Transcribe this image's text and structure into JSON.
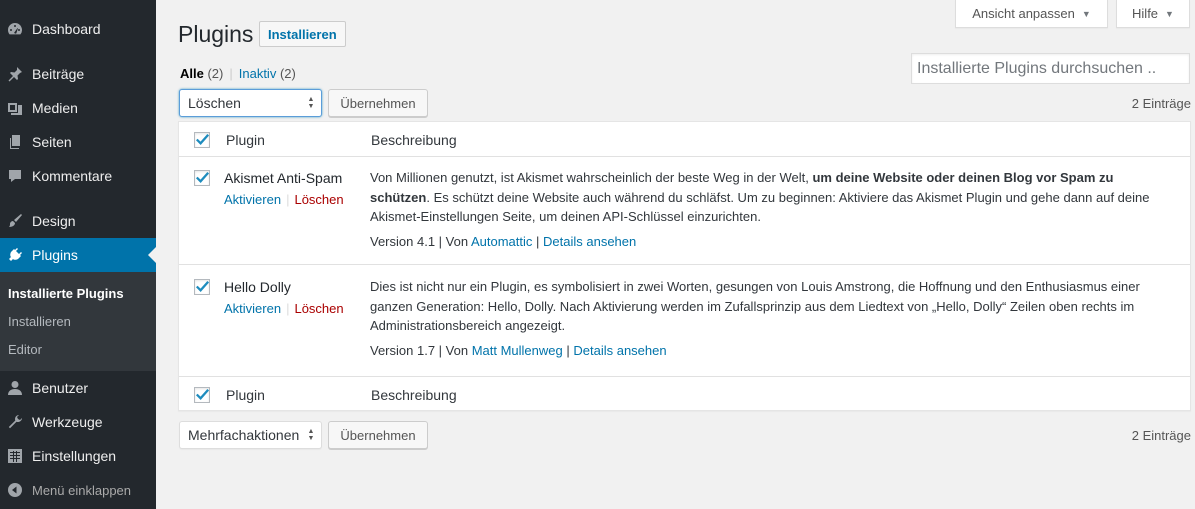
{
  "sidebar": {
    "items": [
      {
        "label": "Dashboard",
        "icon": "dashboard-icon"
      },
      {
        "label": "Beiträge",
        "icon": "pin-icon"
      },
      {
        "label": "Medien",
        "icon": "media-icon"
      },
      {
        "label": "Seiten",
        "icon": "pages-icon"
      },
      {
        "label": "Kommentare",
        "icon": "comment-icon"
      },
      {
        "label": "Design",
        "icon": "paintbrush-icon"
      },
      {
        "label": "Plugins",
        "icon": "plugin-icon"
      },
      {
        "label": "Benutzer",
        "icon": "user-icon"
      },
      {
        "label": "Werkzeuge",
        "icon": "wrench-icon"
      },
      {
        "label": "Einstellungen",
        "icon": "settings-icon"
      }
    ],
    "submenu": [
      "Installierte Plugins",
      "Installieren",
      "Editor"
    ],
    "collapse_label": "Menü einklappen"
  },
  "screen_meta": {
    "screen_options": "Ansicht anpassen",
    "help": "Hilfe"
  },
  "header": {
    "title": "Plugins",
    "add_new": "Installieren"
  },
  "filters": {
    "all_label": "Alle",
    "all_count": "(2)",
    "separator": "|",
    "inactive_label": "Inaktiv",
    "inactive_count": "(2)"
  },
  "search": {
    "placeholder": "Installierte Plugins durchsuchen .."
  },
  "bulk_top": {
    "selected": "Löschen",
    "apply": "Übernehmen",
    "count": "2 Einträge"
  },
  "bulk_bottom": {
    "selected": "Mehrfachaktionen",
    "apply": "Übernehmen",
    "count": "2 Einträge"
  },
  "table": {
    "columns": {
      "plugin": "Plugin",
      "description": "Beschreibung"
    },
    "rows": [
      {
        "name": "Akismet Anti-Spam",
        "activate": "Aktivieren",
        "delete": "Löschen",
        "desc_1": "Von Millionen genutzt, ist Akismet wahrscheinlich der beste Weg in der Welt, ",
        "desc_bold": "um deine Website oder deinen Blog vor Spam zu schützen",
        "desc_2": ". Es schützt deine Website auch während du schläfst. Um zu beginnen: Aktiviere das Akismet Plugin und gehe dann auf deine Akismet-Einstellungen Seite, um deinen API-Schlüssel einzurichten.",
        "version": "Version 4.1",
        "by": "Von",
        "author": "Automattic",
        "details": "Details ansehen"
      },
      {
        "name": "Hello Dolly",
        "activate": "Aktivieren",
        "delete": "Löschen",
        "desc": "Dies ist nicht nur ein Plugin, es symbolisiert in zwei Worten, gesungen von Louis Amstrong, die Hoffnung und den Enthusiasmus einer ganzen Generation: Hello, Dolly. Nach Aktivierung werden im Zufallsprinzip aus dem Liedtext von „Hello, Dolly“ Zeilen oben rechts im Administrationsbereich angezeigt.",
        "version": "Version 1.7",
        "by": "Von",
        "author": "Matt Mullenweg",
        "details": "Details ansehen"
      }
    ]
  },
  "colors": {
    "sidebar_bg": "#23282d",
    "submenu_bg": "#32373c",
    "accent": "#0073aa",
    "link": "#0073aa",
    "delete_link": "#aa0000",
    "page_bg": "#f1f1f1"
  }
}
